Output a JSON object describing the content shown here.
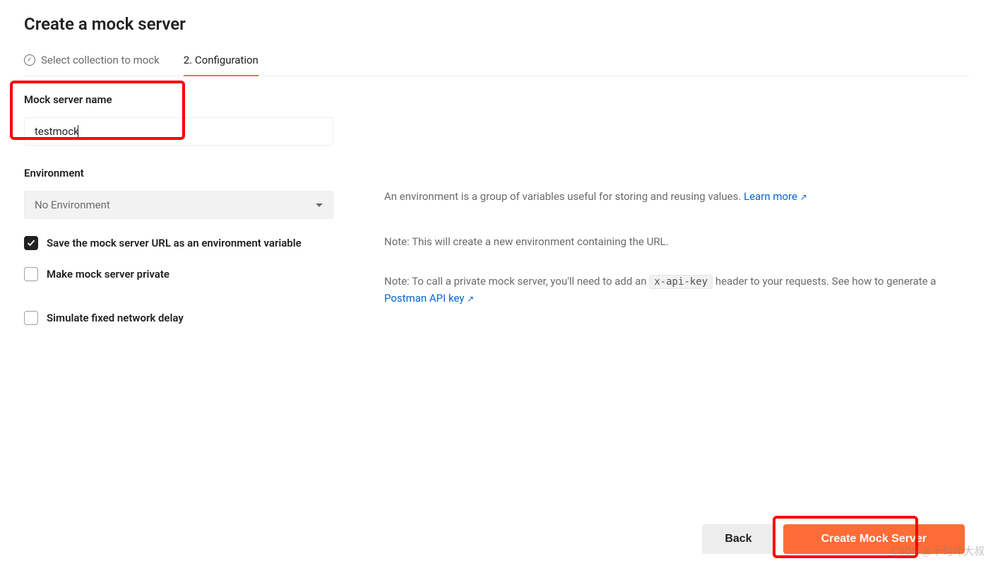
{
  "header": {
    "title": "Create a mock server",
    "step1": "Select collection to mock",
    "step2": "2. Configuration"
  },
  "form": {
    "name_label": "Mock server name",
    "name_value": "testmock",
    "env_label": "Environment",
    "env_selected": "No Environment",
    "check_save_url": "Save the mock server URL as an environment variable",
    "check_private": "Make mock server private",
    "check_delay": "Simulate fixed network delay"
  },
  "help": {
    "env_text": "An environment is a group of variables useful for storing and reusing values. ",
    "env_link": "Learn more",
    "save_url_text": "Note: This will create a new environment containing the URL.",
    "private_pre": "Note: To call a private mock server, you'll need to add an ",
    "private_code": "x-api-key",
    "private_mid": " header to your requests. See how to generate a ",
    "private_link": "Postman API key"
  },
  "footer": {
    "back": "Back",
    "create": "Create Mock Server"
  },
  "watermark": "CSDN @十旬叶大叔"
}
